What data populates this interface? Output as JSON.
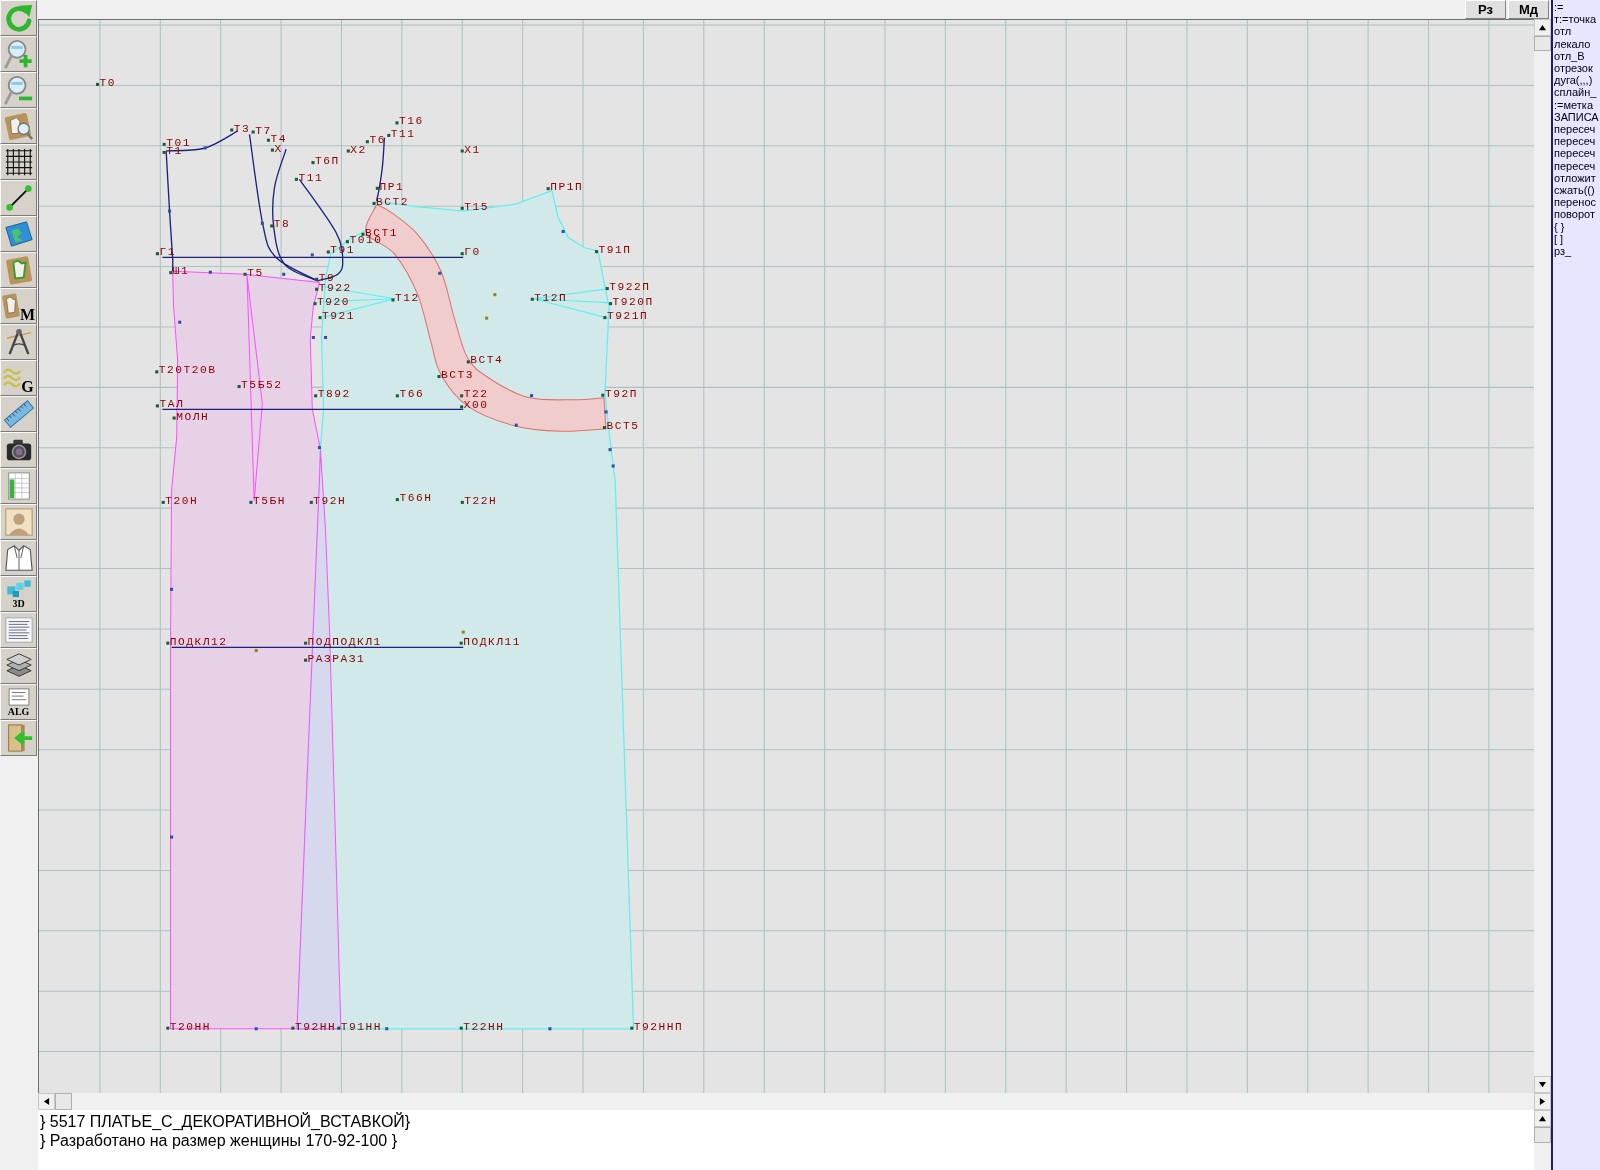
{
  "toolbar": [
    {
      "kind": "refresh"
    },
    {
      "kind": "zoom_in"
    },
    {
      "kind": "zoom_out"
    },
    {
      "kind": "piece_zoom"
    },
    {
      "kind": "grid"
    },
    {
      "kind": "segment"
    },
    {
      "kind": "map"
    },
    {
      "kind": "piece"
    },
    {
      "kind": "piece_m",
      "label": "M"
    },
    {
      "kind": "compass"
    },
    {
      "kind": "curves",
      "label": "G"
    },
    {
      "kind": "ruler"
    },
    {
      "kind": "camera"
    },
    {
      "kind": "table"
    },
    {
      "kind": "portrait"
    },
    {
      "kind": "jacket"
    },
    {
      "kind": "figure_3d",
      "label": "3D"
    },
    {
      "kind": "document"
    },
    {
      "kind": "layers"
    },
    {
      "kind": "algorithm",
      "label": "ALG"
    },
    {
      "kind": "exit"
    }
  ],
  "top_buttons": [
    "Рз",
    "Мд"
  ],
  "drawing": {
    "labels": [
      "Т0",
      "Т16",
      "Т3",
      "Т7",
      "Т11",
      "Т4",
      "Т6",
      "Т01",
      "Т1",
      "Х",
      "Х2",
      "Х1",
      "Т6П",
      "Т11",
      "ПР1",
      "ПР1П",
      "ВСТ2",
      "Т15",
      "Т8",
      "ВСТ1",
      "Т010",
      "Г1",
      "Т91",
      "Г0",
      "Т91П",
      "Ш1",
      "Т5",
      "Т9",
      "Т922",
      "Т922П",
      "Т12",
      "Т12П",
      "Т920",
      "Т920П",
      "Т921",
      "Т921П",
      "ВСТ4",
      "Т20Т20В",
      "ВСТ3",
      "Т5Б52",
      "Т892",
      "Т66",
      "Т22",
      "Т92П",
      "ТАЛ",
      "Х00",
      "МОЛН",
      "ВСТ5",
      "Т66Н",
      "Т20Н",
      "Т5БН",
      "Т92Н",
      "Т22Н",
      "ПОДКЛ12",
      "ПОДПОДКЛ1",
      "ПОДКЛ11",
      "РАЗРАЗ1",
      "Т20НН",
      "Т92НН",
      "Т91НН",
      "Т22НН",
      "Т92ННП"
    ]
  },
  "notes": [
    "} 5517 ПЛАТЬЕ_С_ДЕКОРАТИВНОЙ_ВСТАВКОЙ}",
    "} Разработано на размер женщины 170-92-100 }"
  ],
  "command_list": [
    ":=",
    "т:=точка",
    "отл",
    "лекало",
    "отл_В",
    "отрезок",
    "дуга(,,,)",
    "сплайн_",
    ":=метка",
    "ЗАПИСА",
    "пересеч",
    "пересеч",
    "пересеч",
    "пересеч",
    "отложит",
    "сжать(()",
    "перенос",
    "поворот",
    "{ }",
    "[ ]",
    "рз_"
  ]
}
